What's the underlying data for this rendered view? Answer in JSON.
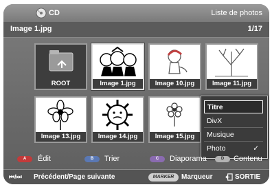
{
  "header": {
    "device": "CD",
    "menu_title": "Liste de photos",
    "icon": "disc-icon"
  },
  "subheader": {
    "current_file": "Image 1.jpg",
    "page_counter": "1/17"
  },
  "thumbnails": [
    {
      "label": "ROOT",
      "icon": "folder-icon"
    },
    {
      "label": "Image 1.jpg",
      "icon": "photo-thumbnail"
    },
    {
      "label": "Image 10.jpg",
      "icon": "photo-thumbnail"
    },
    {
      "label": "Image 11.jpg",
      "icon": "photo-thumbnail"
    },
    {
      "label": "Image 13.jpg",
      "icon": "photo-thumbnail"
    },
    {
      "label": "Image 14.jpg",
      "icon": "photo-thumbnail"
    },
    {
      "label": "Image 15.jpg",
      "icon": "photo-thumbnail"
    }
  ],
  "content_menu": {
    "options": [
      "Titre",
      "DivX",
      "Musique",
      "Photo"
    ],
    "highlighted": "Titre",
    "checked": "Photo",
    "check_mark": "✓"
  },
  "actions": [
    {
      "key": "A",
      "label": "Édit"
    },
    {
      "key": "B",
      "label": "Trier"
    },
    {
      "key": "C",
      "label": "Diaporama"
    },
    {
      "key": "D",
      "label": "Contenu"
    }
  ],
  "footer": {
    "nav_icon": "⏮/⏭",
    "nav_label": "Précédent/Page suivante",
    "marker_key": "MARKER",
    "marker_label": "Marqueur",
    "exit_label": "SORTIE"
  },
  "colors": {
    "key_a": "#c33a3a",
    "key_b": "#5a78b4",
    "key_c": "#8a6bb0",
    "key_d": "#b3b3b3"
  }
}
